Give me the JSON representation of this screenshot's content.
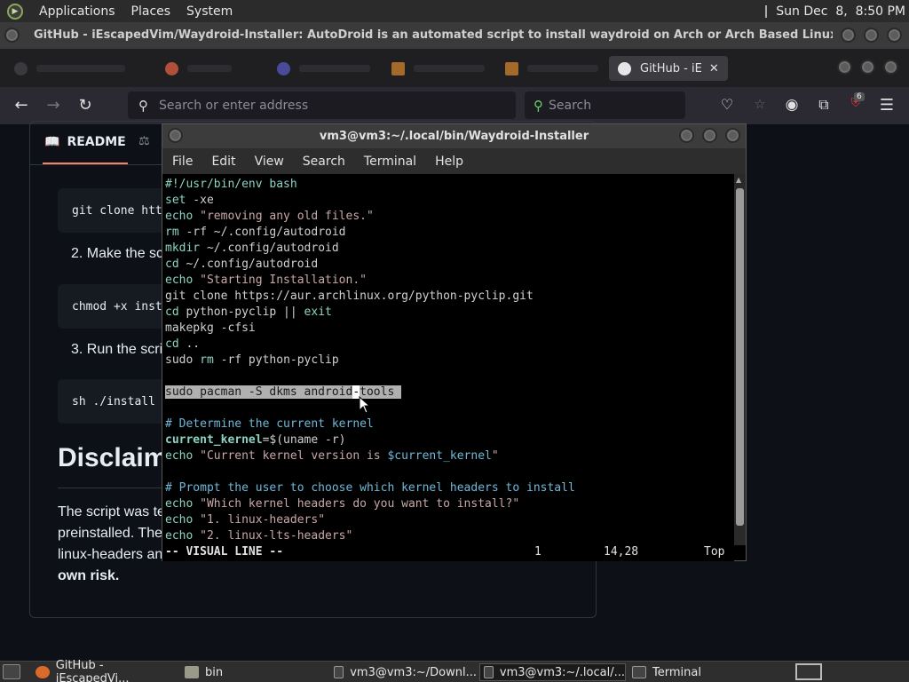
{
  "top_panel": {
    "menus": [
      "Applications",
      "Places",
      "System"
    ],
    "clock": "Sun Dec  8,  8:50 PM"
  },
  "firefox": {
    "window_title": "GitHub - iEscapedVim/Waydroid-Installer: AutoDroid is an automated script to install waydroid on Arch or Arch Based Linux Distros — Mozilla Fi...",
    "active_tab": "GitHub - iE",
    "url_placeholder": "Search or enter address",
    "search_placeholder": "Search",
    "extension_badge": "6"
  },
  "readme": {
    "tab_label": "README",
    "code1": "git clone htt",
    "step2": "2. Make the sc",
    "code2": "chmod +x inst",
    "step3": "3. Run the scri",
    "code3": "sh ./install",
    "disclaimer_heading": "Disclaim",
    "para_line1": "The script was te",
    "para_line2": "preinstalled. The",
    "para_line3": "linux-headers and",
    "para_bold": "own risk."
  },
  "terminal": {
    "title": "vm3@vm3:~/.local/bin/Waydroid-Installer",
    "menus": [
      "File",
      "Edit",
      "View",
      "Search",
      "Terminal",
      "Help"
    ],
    "lines": {
      "l1": "#!/usr/bin/env bash",
      "l2a": "set",
      "l2b": " -xe",
      "l3a": "echo",
      "l3b": " \"removing any old files.\"",
      "l4a": "rm",
      "l4b": " -rf ~/.config/autodroid",
      "l5a": "mkdir",
      "l5b": " ~/.config/autodroid",
      "l6a": "cd",
      "l6b": " ~/.config/autodroid",
      "l7a": "echo",
      "l7b": " \"Starting Installation.\"",
      "l8": "git clone https://aur.archlinux.org/python-pyclip.git",
      "l9a": "cd",
      "l9b": " python-pyclip || ",
      "l9c": "exit",
      "l10": "makepkg -cfsi",
      "l11a": "cd",
      "l11b": " ..",
      "l12a": "sudo ",
      "l12b": "rm",
      "l12c": " -rf python-pyclip",
      "l14a": "sudo pacman -S dkms android",
      "l14b": "-",
      "l14c": "tools ",
      "l16": "# Determine the current kernel",
      "l17a": "current_kernel",
      "l17b": "=$(uname -r)",
      "l18a": "echo",
      "l18b": " \"Current kernel version is ",
      "l18c": "$current_kernel",
      "l18d": "\"",
      "l20": "# Prompt the user to choose which kernel headers to install",
      "l21a": "echo",
      "l21b": " \"Which kernel headers do you want to install?\"",
      "l22a": "echo",
      "l22b": " \"1. linux-headers\"",
      "l23a": "echo",
      "l23b": " \"2. linux-lts-headers\""
    },
    "status": {
      "mode": "-- VISUAL LINE --",
      "count": "1",
      "position": "14,28",
      "scroll": "Top"
    }
  },
  "taskbar": {
    "items": [
      "GitHub - iEscapedVi...",
      "bin",
      "vm3@vm3:~/Downl...",
      "vm3@vm3:~/.local/...",
      "Terminal"
    ]
  },
  "colors": {
    "terminal_bg": "#000000",
    "github_bg": "#0d1117",
    "selection": "#b0b0b0",
    "keyword_green": "#8cd4c4",
    "string": "#c9a8a8",
    "comment": "#6fb8d8"
  }
}
